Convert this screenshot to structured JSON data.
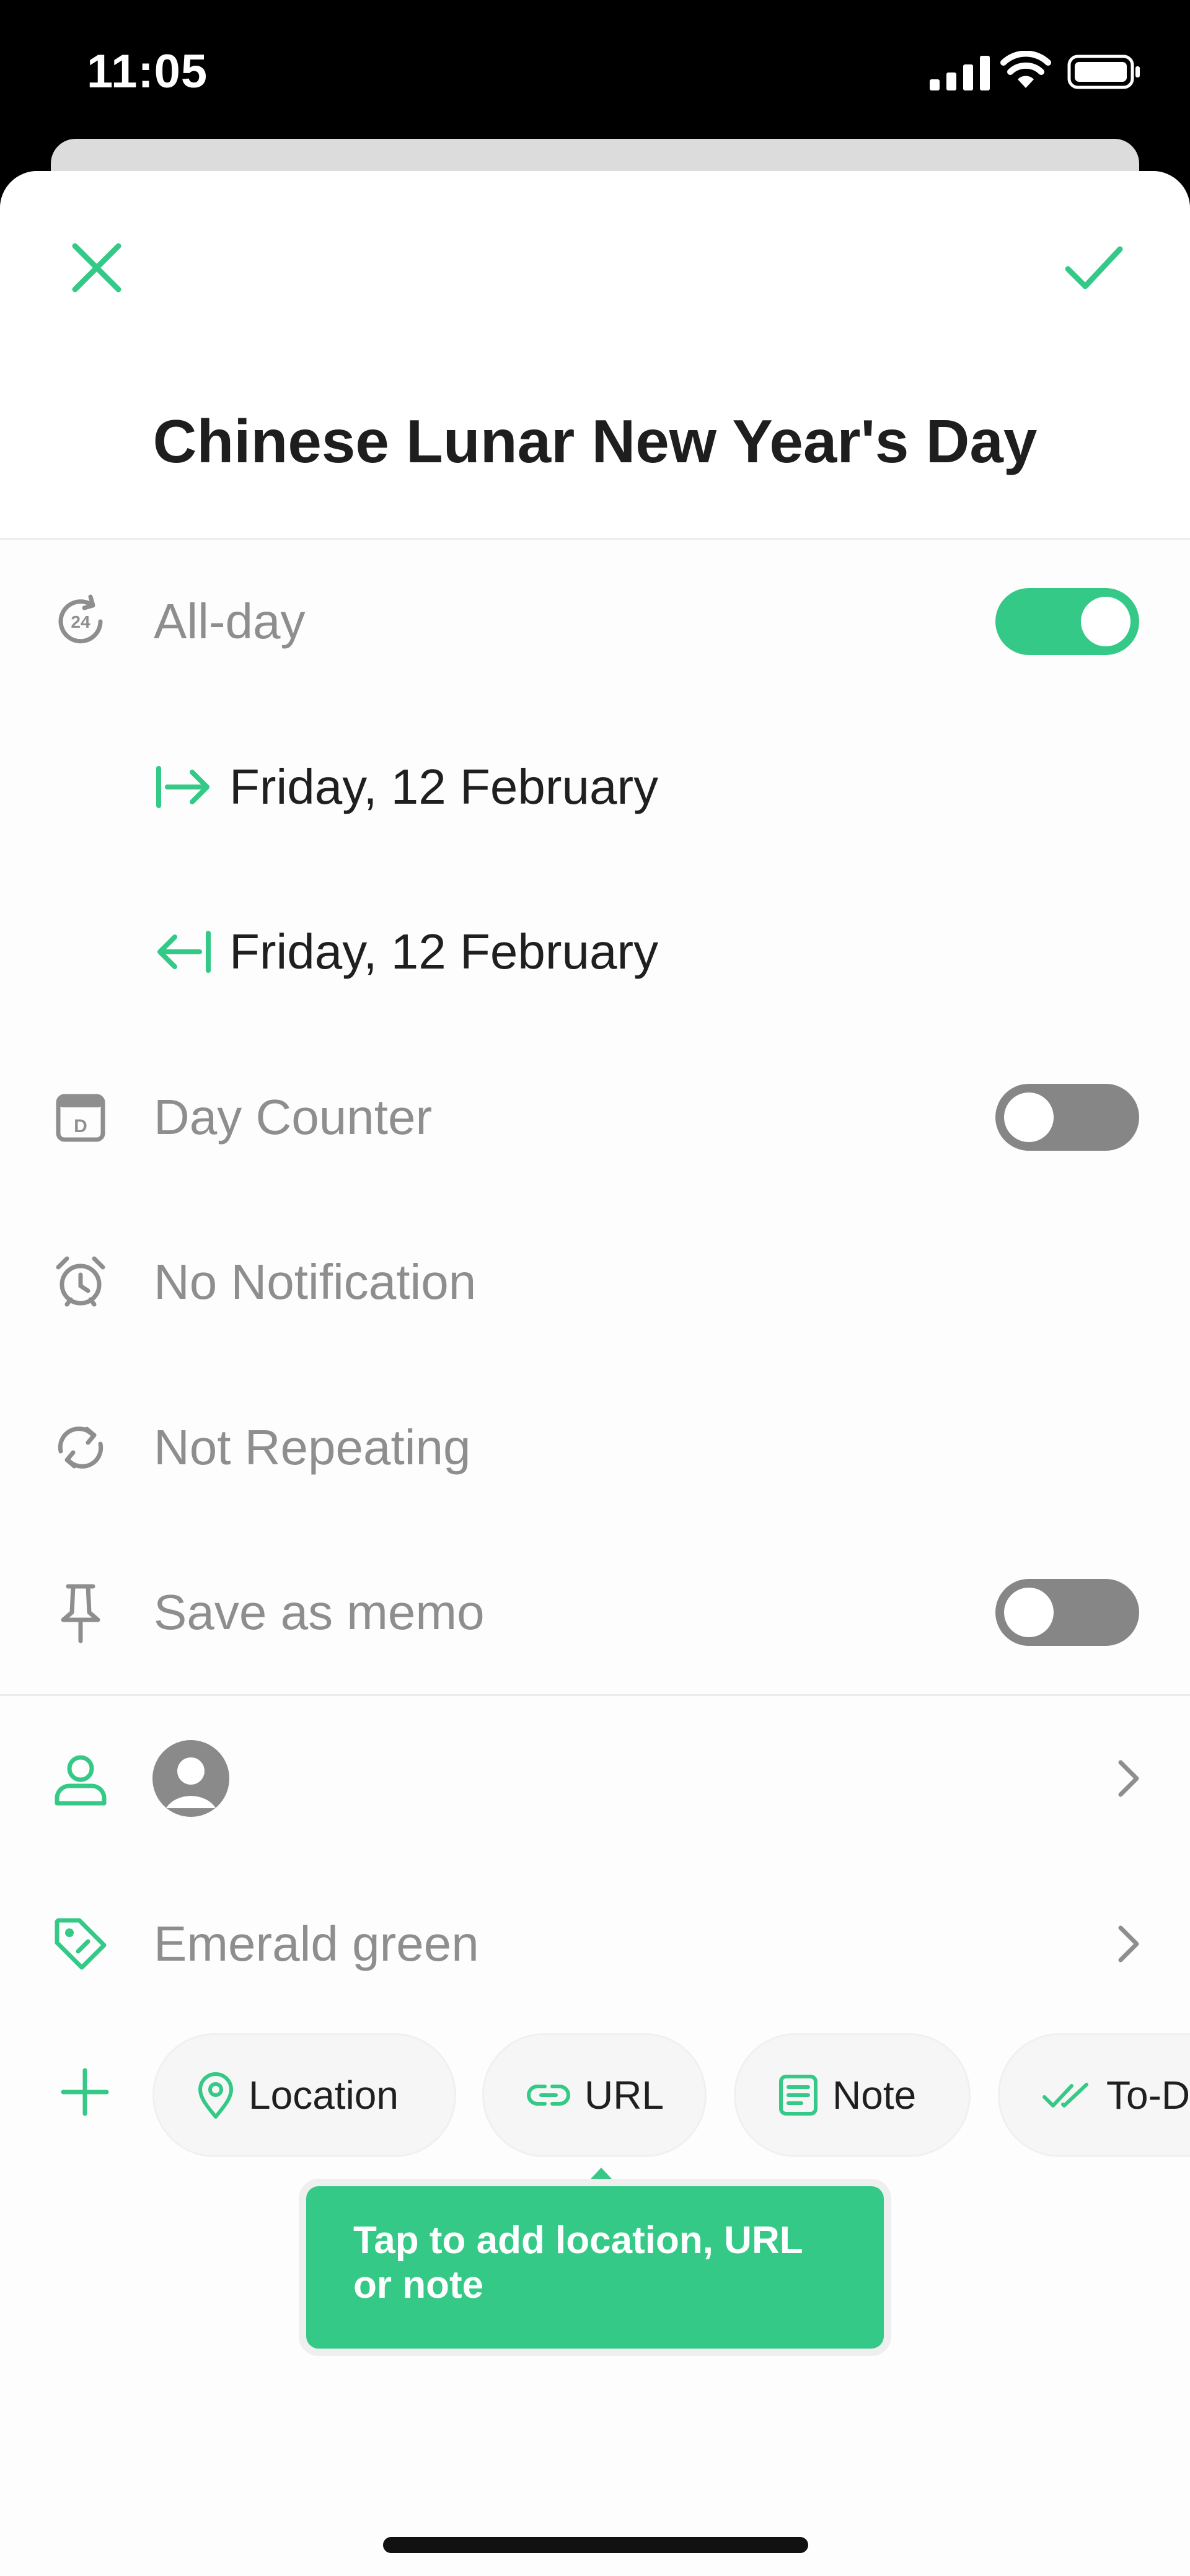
{
  "status_bar": {
    "time": "11:05"
  },
  "header": {
    "title": "Chinese Lunar New Year's Day",
    "close_icon": "close-icon",
    "done_icon": "checkmark-icon"
  },
  "rows": {
    "all_day": {
      "label": "All-day",
      "on": true
    },
    "start_date": {
      "label": "Friday, 12 February"
    },
    "end_date": {
      "label": "Friday, 12 February"
    },
    "day_counter": {
      "label": "Day Counter",
      "on": false
    },
    "notification": {
      "label": "No Notification"
    },
    "repeat": {
      "label": "Not Repeating"
    },
    "memo": {
      "label": "Save as memo",
      "on": false
    },
    "color": {
      "label": "Emerald green"
    }
  },
  "chips": [
    {
      "label": "Location",
      "icon": "location-pin-icon"
    },
    {
      "label": "URL",
      "icon": "link-icon"
    },
    {
      "label": "Note",
      "icon": "note-icon"
    },
    {
      "label": "To-Do",
      "icon": "double-check-icon"
    }
  ],
  "tooltip": {
    "text": "Tap to add location, URL or note"
  },
  "colors": {
    "accent": "#35c987",
    "toggle_off": "#868686",
    "label_gray": "#8e8e8e",
    "text_dark": "#1f1f1f"
  }
}
